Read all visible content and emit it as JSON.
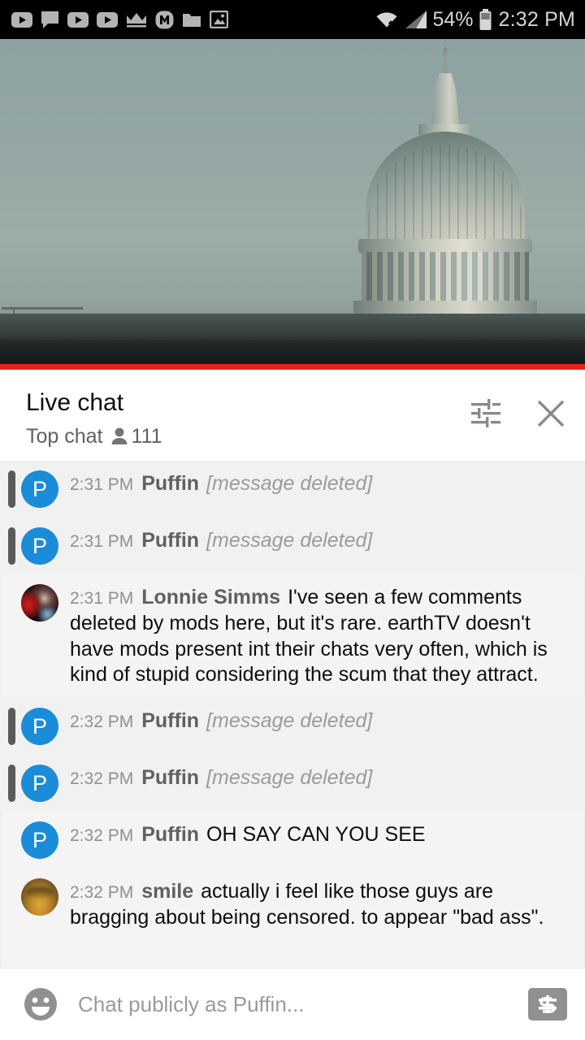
{
  "status_bar": {
    "left_icons": [
      "youtube-icon",
      "chat-bubble-icon",
      "youtube-icon",
      "youtube-icon",
      "crown-icon",
      "m-circle-icon",
      "folder-icon",
      "photo-icon"
    ],
    "wifi_icon": "wifi-icon",
    "signal_icon": "cell-signal-icon",
    "battery_percent": "54%",
    "battery_icon": "battery-icon",
    "clock": "2:32 PM"
  },
  "video": {
    "description": "live-stream-us-capitol-dome",
    "progress_color": "#e62117"
  },
  "chat_header": {
    "title": "Live chat",
    "mode": "Top chat",
    "viewer_icon": "person-icon",
    "viewer_count": "111",
    "tune_icon": "tune-sliders-icon",
    "close_icon": "close-icon"
  },
  "messages": [
    {
      "time": "2:31 PM",
      "author": "Puffin",
      "text": "[message deleted]",
      "deleted": true,
      "avatar_type": "letter",
      "avatar_letter": "P",
      "avatar_color": "#1b8cd8"
    },
    {
      "time": "2:31 PM",
      "author": "Puffin",
      "text": "[message deleted]",
      "deleted": true,
      "avatar_type": "letter",
      "avatar_letter": "P",
      "avatar_color": "#1b8cd8"
    },
    {
      "time": "2:31 PM",
      "author": "Lonnie Simms",
      "text": "I've seen a few comments deleted by mods here, but it's rare. earthTV doesn't have mods present int their chats very often, which is kind of stupid considering the scum that they attract.",
      "deleted": false,
      "avatar_type": "photo-lonnie",
      "avatar_letter": "",
      "avatar_color": "#2a1518"
    },
    {
      "time": "2:32 PM",
      "author": "Puffin",
      "text": "[message deleted]",
      "deleted": true,
      "avatar_type": "letter",
      "avatar_letter": "P",
      "avatar_color": "#1b8cd8"
    },
    {
      "time": "2:32 PM",
      "author": "Puffin",
      "text": "[message deleted]",
      "deleted": true,
      "avatar_type": "letter",
      "avatar_letter": "P",
      "avatar_color": "#1b8cd8"
    },
    {
      "time": "2:32 PM",
      "author": "Puffin",
      "text": "OH SAY CAN YOU SEE",
      "deleted": false,
      "avatar_type": "letter",
      "avatar_letter": "P",
      "avatar_color": "#1b8cd8"
    },
    {
      "time": "2:32 PM",
      "author": "smile",
      "text": "actually i feel like those guys are bragging about being censored. to appear \"bad ass\".",
      "deleted": false,
      "avatar_type": "photo-smile",
      "avatar_letter": "",
      "avatar_color": "#c08a2c"
    }
  ],
  "composer": {
    "emoji_icon": "emoji-smiley-icon",
    "placeholder": "Chat publicly as Puffin...",
    "value": "",
    "superchat_icon": "dollar-bill-icon"
  }
}
